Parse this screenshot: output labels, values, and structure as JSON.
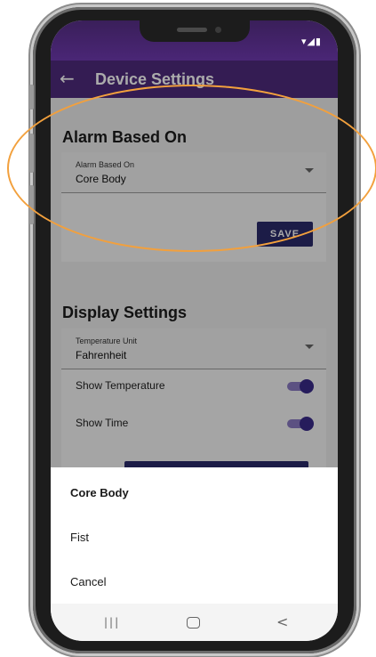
{
  "status_bar": {
    "icons": "▾◢▮"
  },
  "app_bar": {
    "back_icon": "←",
    "title": "Device Settings"
  },
  "alarm_section": {
    "title": "Alarm Based On",
    "dropdown": {
      "label": "Alarm Based On",
      "value": "Core Body"
    },
    "save_label": "SAVE"
  },
  "display_section": {
    "title": "Display Settings",
    "dropdown": {
      "label": "Temperature Unit",
      "value": "Fahrenheit"
    },
    "toggles": [
      {
        "label": "Show Temperature",
        "on": true
      },
      {
        "label": "Show Time",
        "on": true
      }
    ]
  },
  "bottom_sheet": {
    "options": [
      "Core Body",
      "Fist",
      "Cancel"
    ],
    "selected": "Core Body"
  },
  "nav_bar": {
    "recents_icon": "|||",
    "back_icon": "<"
  },
  "colors": {
    "app_bar": "#4e2a7c",
    "primary_button": "#2a2a6b",
    "toggle_thumb": "#3a2a8a",
    "annotation": "#f2a03d"
  }
}
